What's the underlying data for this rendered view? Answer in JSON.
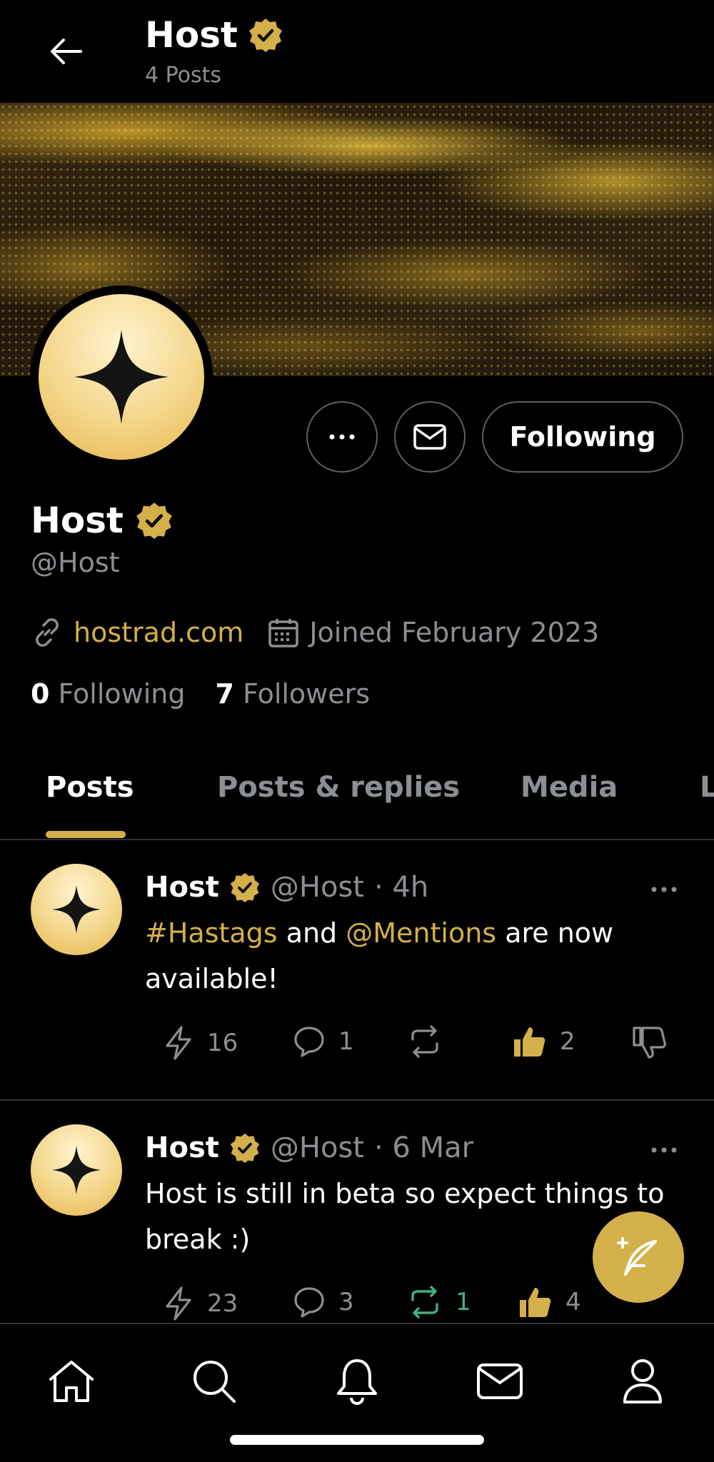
{
  "header": {
    "title": "Host",
    "subtitle": "4 Posts"
  },
  "profile": {
    "name": "Host",
    "handle": "@Host",
    "website": "hostrad.com",
    "joined": "Joined February 2023",
    "following_count": "0",
    "following_label": "Following",
    "followers_count": "7",
    "followers_label": "Followers",
    "follow_button_label": "Following"
  },
  "tabs": [
    {
      "label": "Posts",
      "active": true
    },
    {
      "label": "Posts & replies",
      "active": false
    },
    {
      "label": "Media",
      "active": false
    },
    {
      "label": "L",
      "active": false
    }
  ],
  "posts": [
    {
      "name": "Host",
      "handle": "@Host",
      "time": "· 4h",
      "text_parts": {
        "hashtag": "#Hastags",
        "and": " and ",
        "mention": "@Mentions",
        "rest": " are now available!"
      },
      "zaps": "16",
      "replies": "1",
      "reposts": "",
      "likes": "2"
    },
    {
      "name": "Host",
      "handle": "@Host",
      "time": "· 6 Mar",
      "text": "Host is still in beta so expect things to break :)",
      "zaps": "23",
      "replies": "3",
      "reposts": "1",
      "likes": "4"
    }
  ],
  "colors": {
    "accent": "#d4b04a",
    "repost_active": "#3fb27f",
    "muted": "#8b8f94",
    "background": "#000000"
  },
  "icons": {
    "back": "arrow-left-icon",
    "verified": "verified-badge-icon",
    "more": "ellipsis-icon",
    "message": "envelope-icon",
    "link": "link-icon",
    "calendar": "calendar-icon",
    "zap": "lightning-icon",
    "reply": "speech-bubble-icon",
    "repost": "repost-icon",
    "like": "thumbs-up-icon",
    "dislike": "thumbs-down-icon",
    "compose": "feather-plus-icon",
    "home": "home-icon",
    "search": "search-icon",
    "notifications": "bell-icon",
    "messages": "envelope-icon",
    "profile": "person-icon"
  }
}
